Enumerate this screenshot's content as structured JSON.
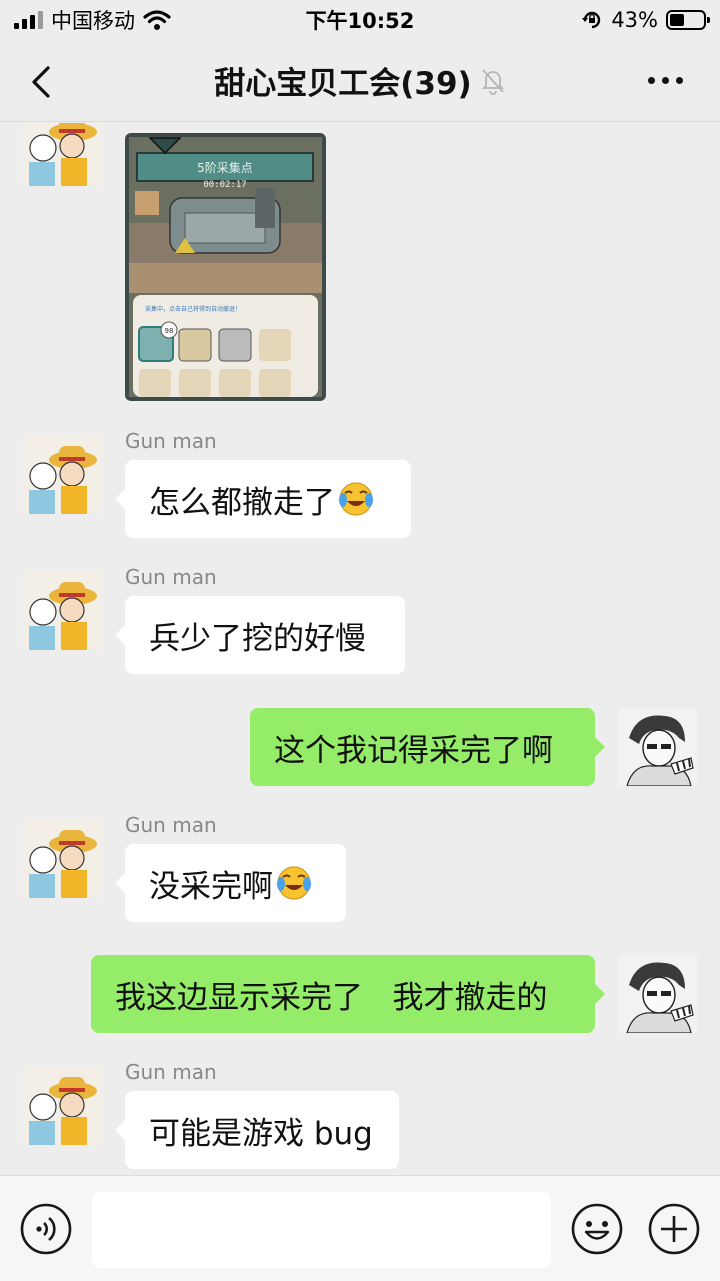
{
  "status_bar": {
    "carrier": "中国移动",
    "time": "下午10:52",
    "battery": "43%",
    "battery_level": 0.43
  },
  "header": {
    "title": "甜心宝贝工会(39)",
    "muted": true
  },
  "image_message": {
    "panel_title": "5阶采集点",
    "timer": "00:02:17",
    "hint": "采集中，点击自己将得到自动撤退！",
    "count": "98"
  },
  "messages": [
    {
      "sender": "Gun man",
      "text": "怎么都撤走了",
      "emoji": "crying-laughing-emoji"
    },
    {
      "sender": "Gun man",
      "text": "兵少了挖的好慢"
    },
    {
      "text": "这个我记得采完了啊"
    },
    {
      "sender": "Gun man",
      "text": "没采完啊",
      "emoji": "crying-laughing-emoji"
    },
    {
      "text": "我这边显示采完了   我才撤走的"
    },
    {
      "sender": "Gun man",
      "text": "可能是游戏 bug"
    }
  ],
  "input_bar": {
    "placeholder": "",
    "icons": [
      "voice-icon",
      "emoji-icon",
      "plus-icon"
    ]
  },
  "colors": {
    "outgoing_bubble": "#95ec69",
    "incoming_bubble": "#ffffff",
    "background": "#ededed"
  }
}
